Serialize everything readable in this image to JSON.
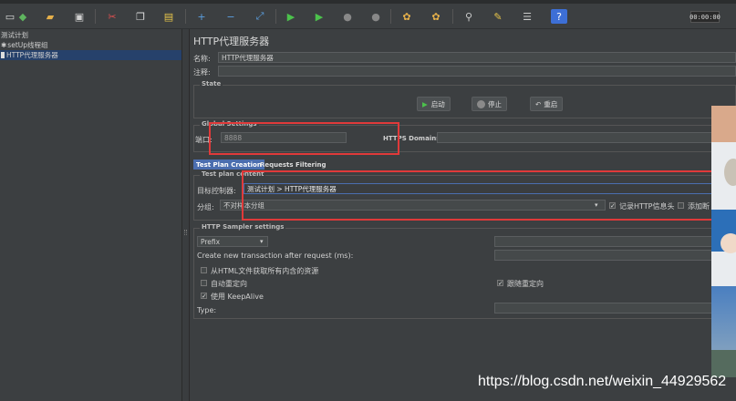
{
  "toolbar": {
    "timer": "00:00:00",
    "icons": [
      "new-icon",
      "templates-icon",
      "open-icon",
      "save-icon",
      "cut-icon",
      "copy-icon",
      "paste-icon",
      "expand-icon",
      "collapse-icon",
      "toggle-icon",
      "start-icon",
      "start-no-pause-icon",
      "stop-icon",
      "shutdown-icon",
      "clear-icon",
      "clear-all-icon",
      "search-icon",
      "reset-search-icon",
      "function-helper-icon",
      "help-icon"
    ]
  },
  "tree": {
    "items": [
      {
        "label": "测试计划"
      },
      {
        "label": "setUp线程组"
      },
      {
        "label": "HTTP代理服务器"
      }
    ]
  },
  "panel": {
    "title": "HTTP代理服务器",
    "name_label": "名称:",
    "name_value": "HTTP代理服务器",
    "comment_label": "注释:",
    "comment_value": "",
    "state": {
      "title": "State",
      "start": "启动",
      "stop": "停止",
      "restart": "重启"
    },
    "global": {
      "title": "Global Settings",
      "port_label": "端口:",
      "port_value": "8888",
      "https_label": "HTTPS Domains:",
      "https_value": ""
    },
    "tabs": [
      "Test Plan Creation",
      "Requests Filtering"
    ],
    "test_plan": {
      "title": "Test plan content",
      "target_label": "目标控制器:",
      "target_value": "测试计划 > HTTP代理服务器",
      "group_label": "分组:",
      "group_value": "不对样本分组",
      "record_headers": "记录HTTP信息头",
      "add_assertions": "添加断"
    },
    "sampler": {
      "title": "HTTP Sampler settings",
      "prefix_value": "Prefix",
      "create_tx_label": "Create new transaction after request (ms):",
      "retrieve_embedded": "从HTML文件获取所有内含的资源",
      "auto_redirect": "自动重定向",
      "follow_redirect": "跟随重定向",
      "keepalive": "使用 KeepAlive",
      "type_label": "Type:"
    }
  },
  "watermark": "https://blog.csdn.net/weixin_44929562",
  "colors": {
    "background": "#3c3f41",
    "selection": "#26416b",
    "annotation_red": "#e03a3a"
  }
}
